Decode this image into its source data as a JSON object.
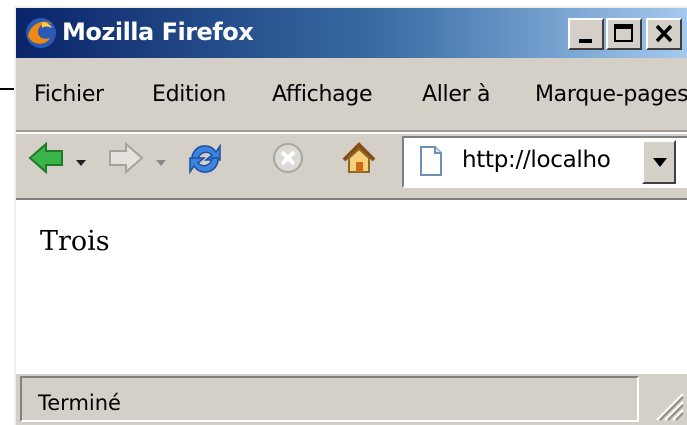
{
  "window": {
    "title": "Mozilla Firefox"
  },
  "menu": [
    {
      "label": "Fichier"
    },
    {
      "label": "Edition"
    },
    {
      "label": "Affichage"
    },
    {
      "label": "Aller à"
    },
    {
      "label": "Marque-pages"
    }
  ],
  "toolbar": {
    "back_icon": "back-arrow-icon",
    "forward_icon": "forward-arrow-icon",
    "reload_icon": "reload-icon",
    "stop_icon": "stop-icon",
    "home_icon": "home-icon",
    "url_value": "http://localho"
  },
  "content": {
    "text": "Trois"
  },
  "status": {
    "text": "Terminé"
  },
  "colors": {
    "titlebar_start": "#0a246a",
    "titlebar_end": "#a6caf0",
    "chrome": "#d4d0c8",
    "back_arrow": "#39b54a"
  }
}
